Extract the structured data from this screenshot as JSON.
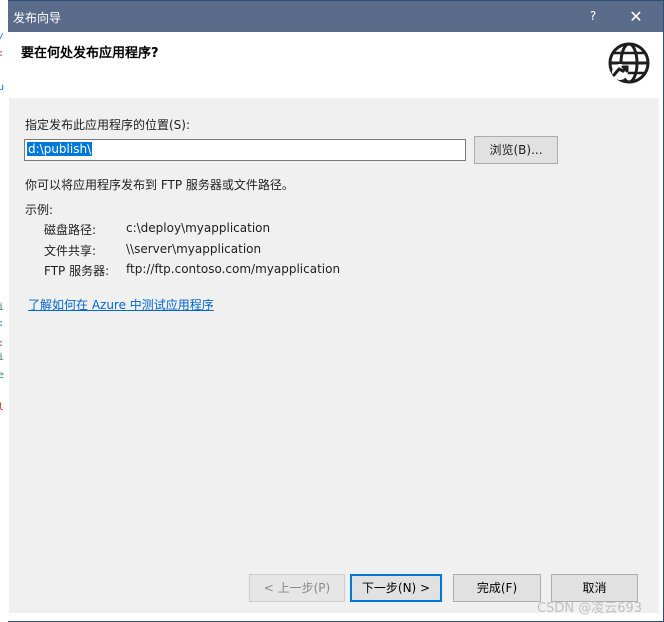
{
  "window": {
    "title": "发布向导",
    "help_label": "?",
    "close_label": "✕"
  },
  "header": {
    "heading": "要在何处发布应用程序?",
    "icon": "globe-icon"
  },
  "form": {
    "location_label": "指定发布此应用程序的位置(S):",
    "location_value": "d:\\publish\\",
    "browse_label": "浏览(B)...",
    "hint": "你可以将应用程序发布到 FTP 服务器或文件路径。",
    "examples_title": "示例:",
    "examples": [
      {
        "key": "磁盘路径:",
        "value": "c:\\deploy\\myapplication"
      },
      {
        "key": "文件共享:",
        "value": "\\\\server\\myapplication"
      },
      {
        "key": "FTP 服务器:",
        "value": "ftp://ftp.contoso.com/myapplication"
      }
    ],
    "link": "了解如何在 Azure 中测试应用程序"
  },
  "buttons": {
    "back": "< 上一步(P)",
    "next": "下一步(N) >",
    "finish": "完成(F)",
    "cancel": "取消"
  },
  "watermark": "CSDN @凌云693",
  "colors": {
    "titlebar": "#5b6c8a",
    "accent": "#0078d7",
    "link": "#0066cc",
    "body_bg": "#f0f0f0"
  }
}
